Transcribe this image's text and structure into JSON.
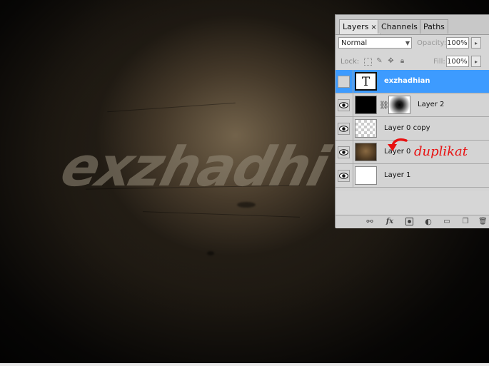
{
  "canvas": {
    "watermark_text": "exzhadhi"
  },
  "panel": {
    "tabs": [
      {
        "label": "Layers",
        "close": "×"
      },
      {
        "label": "Channels"
      },
      {
        "label": "Paths"
      }
    ],
    "blend_mode": "Normal",
    "opacity_label": "Opacity:",
    "opacity_value": "100%",
    "lock_label": "Lock:",
    "fill_label": "Fill:",
    "fill_value": "100%",
    "layers": [
      {
        "name": "exzhadhian",
        "kind": "text",
        "thumb_glyph": "T",
        "visible": false,
        "selected": true
      },
      {
        "name": "Layer 2",
        "kind": "masked",
        "visible": true,
        "selected": false
      },
      {
        "name": "Layer 0 copy",
        "kind": "transparent",
        "visible": true,
        "selected": false
      },
      {
        "name": "Layer 0",
        "kind": "texture",
        "visible": true,
        "selected": false
      },
      {
        "name": "Layer 1",
        "kind": "white",
        "visible": true,
        "selected": false
      }
    ],
    "bottom_icons": [
      "link-icon",
      "fx-icon",
      "mask-icon",
      "adjustment-icon",
      "group-folder-icon",
      "new-layer-icon",
      "trash-icon"
    ],
    "fx_label": "fx"
  },
  "annotation": {
    "text": "duplikat",
    "color": "#e81010"
  },
  "colors": {
    "selection": "#3d9bff"
  }
}
